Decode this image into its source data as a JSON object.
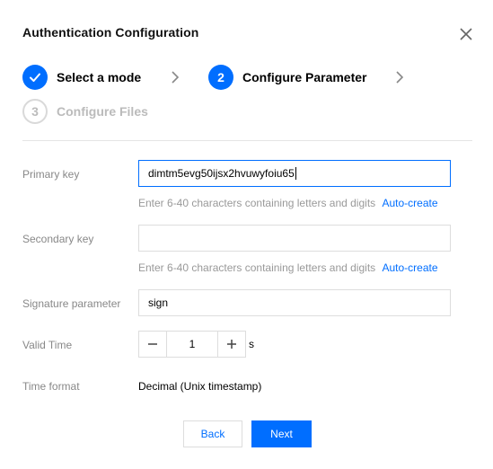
{
  "dialog": {
    "title": "Authentication Configuration"
  },
  "steps": [
    {
      "number": "",
      "label": "Select a mode",
      "state": "done"
    },
    {
      "number": "2",
      "label": "Configure Parameter",
      "state": "active"
    },
    {
      "number": "3",
      "label": "Configure Files",
      "state": "pending"
    }
  ],
  "form": {
    "primary_key": {
      "label": "Primary key",
      "value": "dimtm5evg50ijsx2hvuwyfoiu65",
      "hint": "Enter 6-40 characters containing letters and digits",
      "link": "Auto-create"
    },
    "secondary_key": {
      "label": "Secondary key",
      "value": "",
      "hint": "Enter 6-40 characters containing letters and digits",
      "link": "Auto-create"
    },
    "signature_parameter": {
      "label": "Signature parameter",
      "value": "sign"
    },
    "valid_time": {
      "label": "Valid Time",
      "value": "1",
      "unit": "s"
    },
    "time_format": {
      "label": "Time format",
      "value": "Decimal (Unix timestamp)"
    }
  },
  "footer": {
    "back_label": "Back",
    "next_label": "Next"
  },
  "colors": {
    "accent": "#006eff",
    "border": "#dddddd",
    "muted": "#888888"
  }
}
